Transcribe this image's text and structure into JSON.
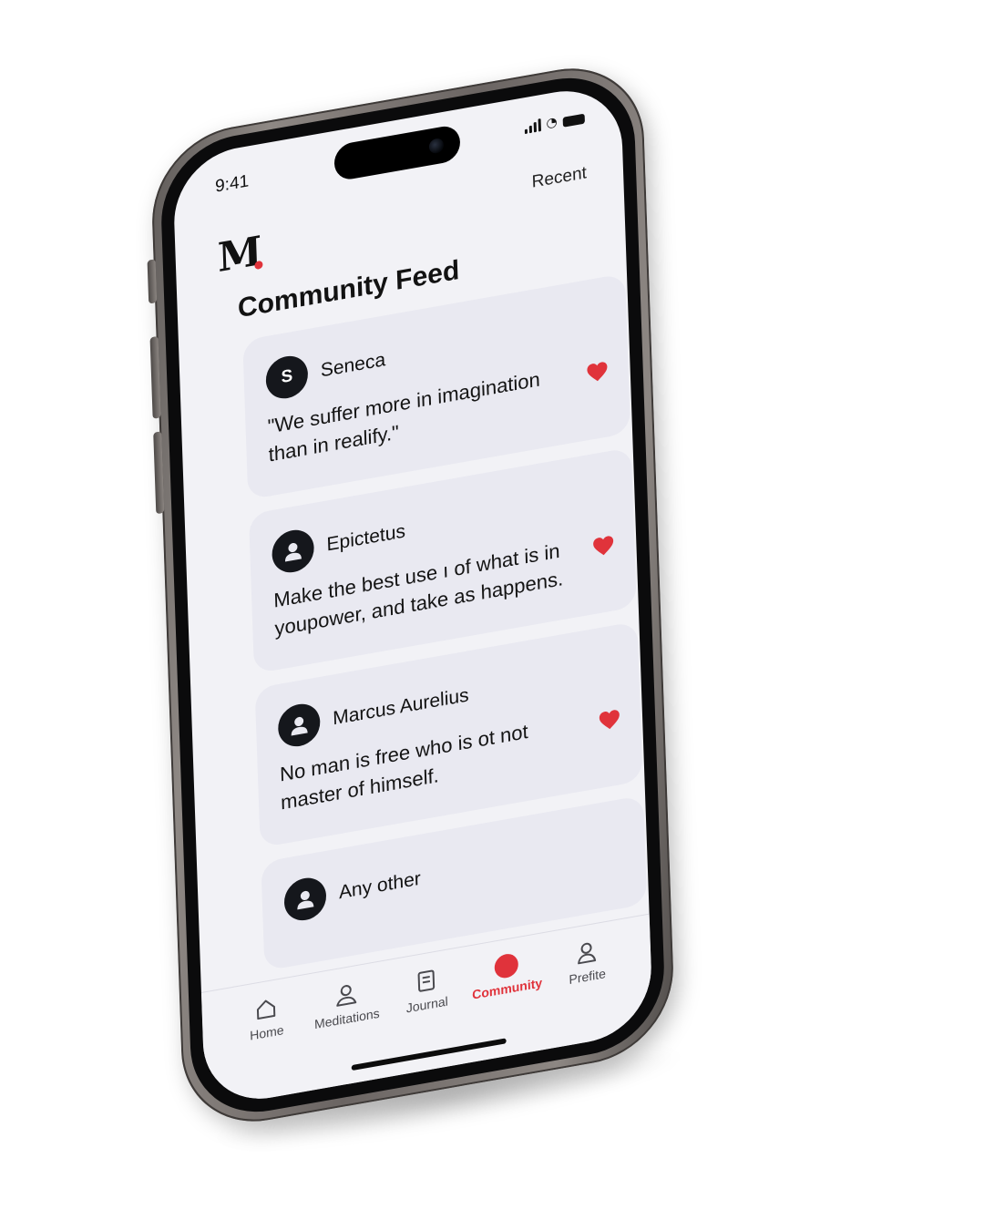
{
  "status_bar": {
    "time": "9:41"
  },
  "header": {
    "logo": "M",
    "recent_label": "Recent",
    "title": "Community Feed"
  },
  "feed": [
    {
      "author": "Seneca",
      "avatar_text": "S",
      "quote": "\"We suffer more in imagination than in realify.\"",
      "liked": true
    },
    {
      "author": "Epictetus",
      "avatar_text": "",
      "quote": "Make the best use ı of what is in youpower, and take as happens.",
      "liked": true
    },
    {
      "author": "Marcus Aurelius",
      "avatar_text": "",
      "quote": "No man is free who is ot not master of himself.",
      "liked": true
    },
    {
      "author": "Any other",
      "avatar_text": "",
      "quote": "",
      "liked": false
    }
  ],
  "tabbar": {
    "items": [
      {
        "label": "Home",
        "icon": "home-icon",
        "active": false
      },
      {
        "label": "Meditations",
        "icon": "meditations-icon",
        "active": false
      },
      {
        "label": "Journal",
        "icon": "journal-icon",
        "active": false
      },
      {
        "label": "Community",
        "icon": "community-icon",
        "active": true
      },
      {
        "label": "Prefite",
        "icon": "profile-icon",
        "active": false
      }
    ]
  },
  "colors": {
    "accent": "#e0333b",
    "screen_bg": "#f2f2f6",
    "card_bg": "#e9e9f1",
    "avatar_bg": "#15171c"
  }
}
